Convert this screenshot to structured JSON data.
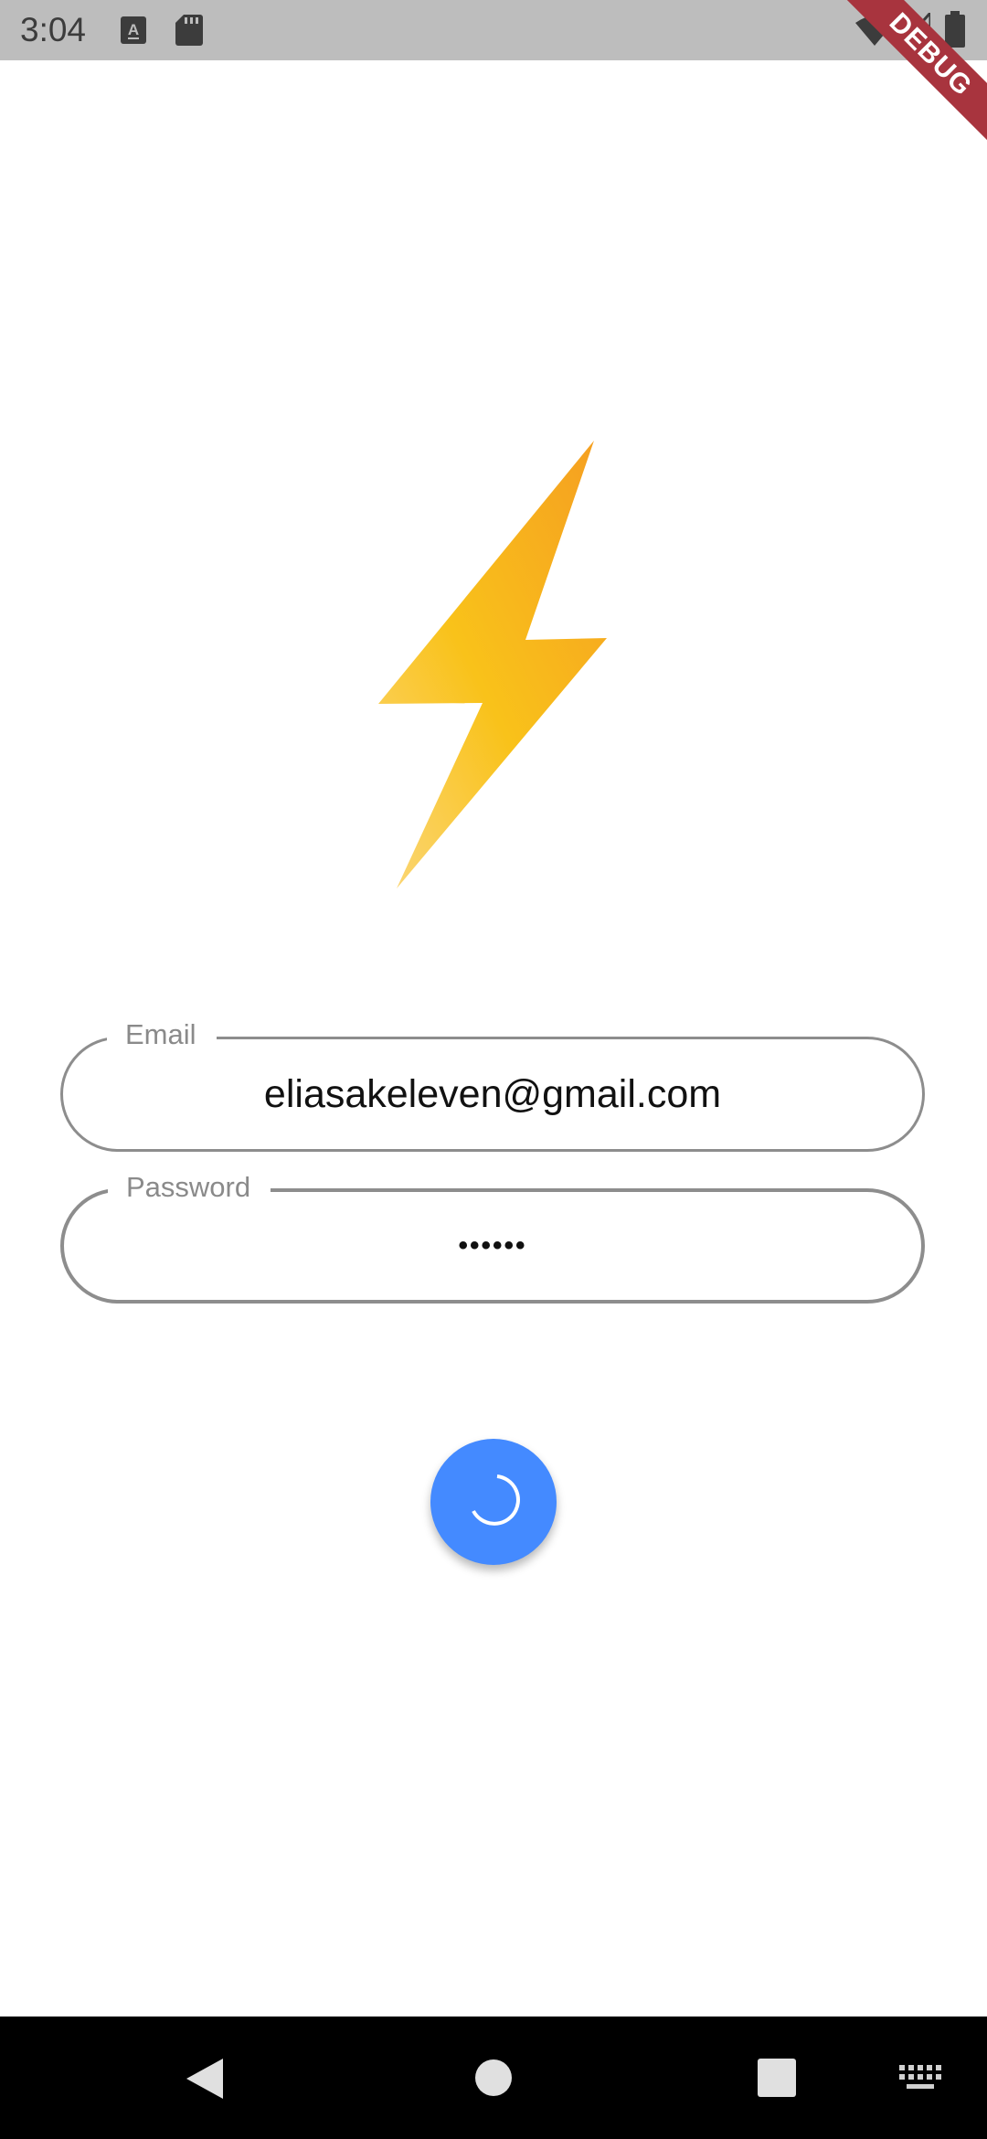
{
  "status_bar": {
    "time": "3:04",
    "icons": [
      "keyboard-a-icon",
      "sd-card-icon",
      "wifi-icon",
      "signal-icon",
      "battery-icon"
    ]
  },
  "debug_banner": {
    "label": "DEBUG"
  },
  "logo": {
    "icon": "lightning-bolt-icon",
    "colors": [
      "#f59e21",
      "#f9c21a",
      "#fbd77a"
    ]
  },
  "form": {
    "email": {
      "label": "Email",
      "value": "eliasakeleven@gmail.com"
    },
    "password": {
      "label": "Password",
      "value": "••••••"
    }
  },
  "submit_button": {
    "state": "loading",
    "color": "#448aff",
    "icon": "spinner-icon"
  },
  "nav_bar": {
    "buttons": [
      "back-icon",
      "home-icon",
      "recents-icon",
      "keyboard-icon"
    ]
  }
}
